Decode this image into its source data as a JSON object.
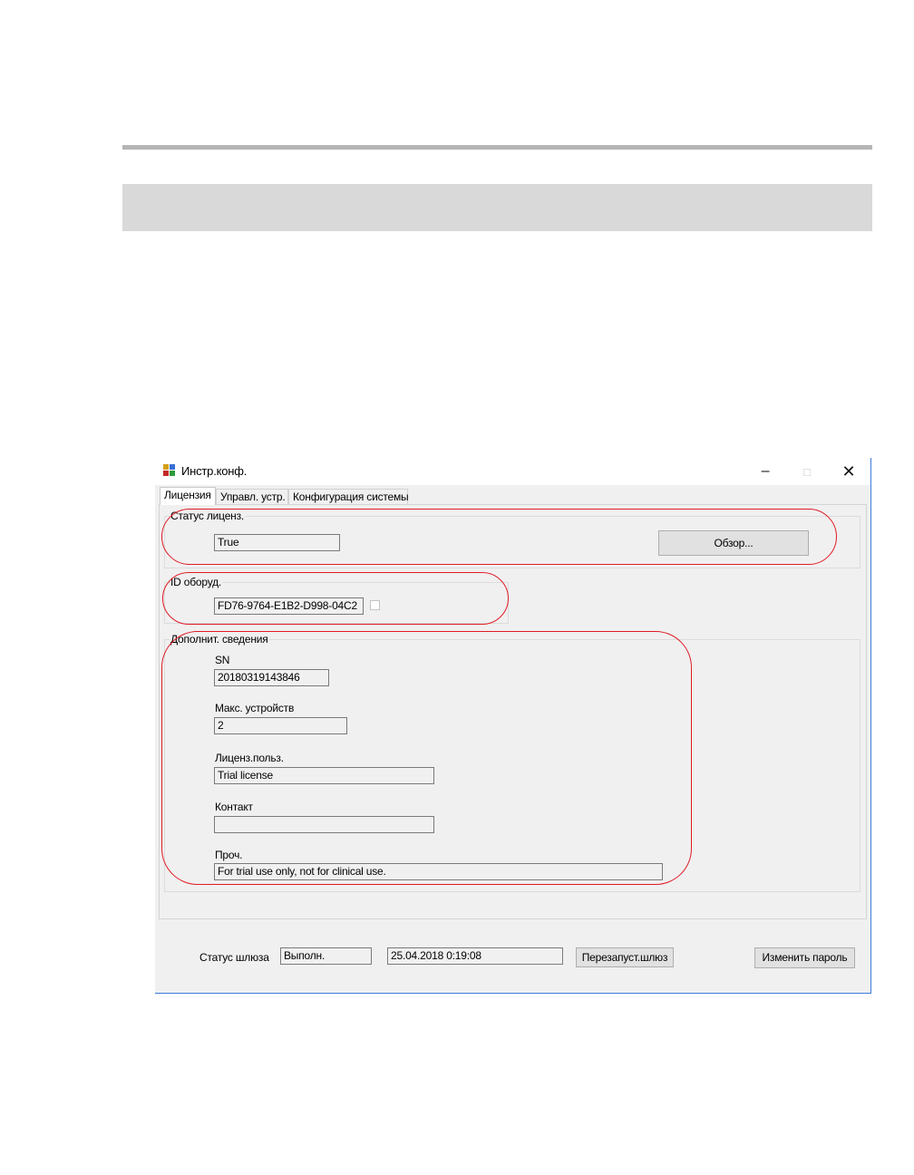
{
  "window": {
    "title": "Инстр.конф.",
    "controls": {
      "minimize": "–",
      "maximize": "□",
      "close": "✕"
    }
  },
  "tabs": [
    {
      "label": "Лицензия",
      "active": true
    },
    {
      "label": "Управл. устр.",
      "active": false
    },
    {
      "label": "Конфигурация системы",
      "active": false
    }
  ],
  "license_status": {
    "group_title": "Статус лиценз.",
    "value": "True",
    "browse_button": "Обзор..."
  },
  "hardware_id": {
    "group_title": "ID оборуд.",
    "value": "FD76-9764-E1B2-D998-04C2",
    "checkbox_checked": false
  },
  "additional_info": {
    "group_title": "Дополнит. сведения",
    "fields": [
      {
        "label": "SN",
        "value": "20180319143846"
      },
      {
        "label": "Макс. устройств",
        "value": "2"
      },
      {
        "label": "Лиценз.польз.",
        "value": "Trial license"
      },
      {
        "label": "Контакт",
        "value": ""
      },
      {
        "label": "Проч.",
        "value": "For trial use only, not for clinical use."
      }
    ]
  },
  "footer": {
    "gateway_status_label": "Статус шлюза",
    "gateway_status_value": "Выполн.",
    "timestamp": "25.04.2018 0:19:08",
    "restart_button": "Перезапуст.шлюз",
    "change_password_button": "Изменить пароль"
  },
  "colors": {
    "callout": "#e01a24",
    "window_border": "#3b7dd8",
    "page_rule": "#b5b5b5",
    "page_band": "#d9d9d9"
  }
}
